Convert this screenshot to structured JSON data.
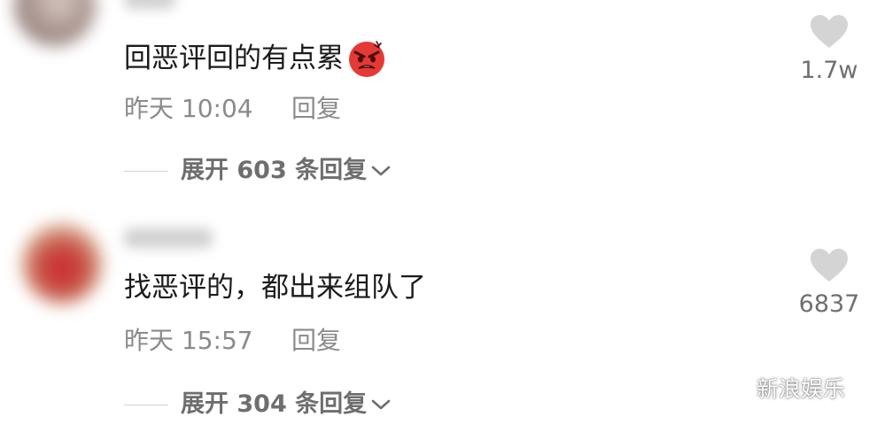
{
  "comments": [
    {
      "text": "回恶评回的有点累",
      "emoji": "angry-face-emoji",
      "time": "昨天 10:04",
      "reply_label": "回复",
      "expand_label": "展开 603 条回复",
      "like_count": "1.7w"
    },
    {
      "text": "找恶评的，都出来组队了",
      "time": "昨天 15:57",
      "reply_label": "回复",
      "expand_label": "展开 304 条回复",
      "like_count": "6837"
    }
  ],
  "watermark": {
    "icon": "wechat-icon",
    "text": "新浪娱乐"
  },
  "colors": {
    "text_primary": "#1b1b1b",
    "text_secondary": "#8a8a8a",
    "heart": "#d4d4d4",
    "emoji_red": "#e53935"
  }
}
